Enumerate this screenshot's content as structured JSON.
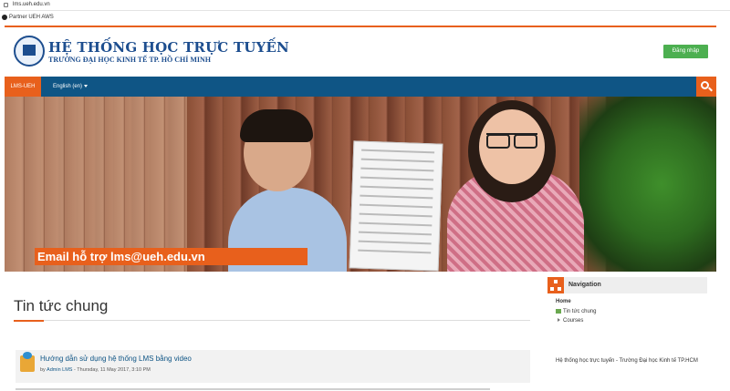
{
  "browser": {
    "url": "lms.ueh.edu.vn",
    "bookmark": "Partner UEH AWS"
  },
  "header": {
    "title": "HỆ THỐNG HỌC TRỰC TUYẾN",
    "subtitle": "TRƯỜNG ĐẠI HỌC KINH TẾ TP. HỒ CHÍ MINH",
    "login_label": "Đăng nhập"
  },
  "navbar": {
    "home_label": "LMS-UEH",
    "language_label": "English (en)"
  },
  "hero": {
    "caption": "Email hỗ trợ lms@ueh.edu.vn"
  },
  "news": {
    "heading": "Tin tức chung",
    "post": {
      "title": "Hướng dẫn sử dụng hệ thống LMS bằng video",
      "by": "by",
      "author": "Admin LMS",
      "date": "- Thursday, 11 May 2017, 3:10 PM"
    }
  },
  "navigation": {
    "heading": "Navigation",
    "home": "Home",
    "item1": "Tin tức chung",
    "item2": "Courses"
  },
  "footer": {
    "text": "Hệ thống học trực tuyến - Trường Đại học Kinh tế TP.HCM"
  },
  "colors": {
    "accent": "#e8601c",
    "navbar": "#0f5585",
    "login": "#4caf50",
    "brand": "#1d4e8f"
  }
}
